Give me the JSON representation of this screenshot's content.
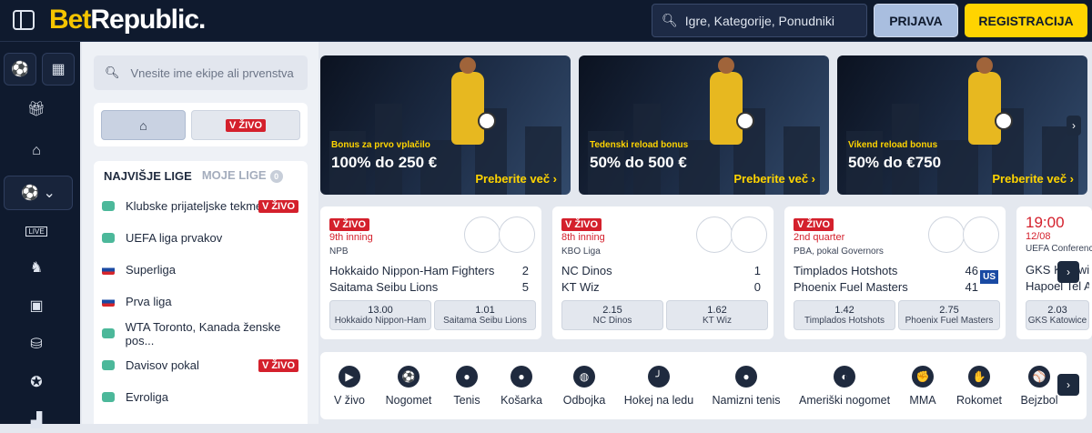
{
  "header": {
    "logo_bet": "Bet",
    "logo_republic": "Republic.",
    "search_placeholder": "Igre, Kategorije, Ponudniki",
    "login": "PRIJAVA",
    "register": "REGISTRACIJA"
  },
  "rail": {
    "icons": [
      "sports-icon",
      "casino-icon",
      "gift-icon",
      "home-icon",
      "football-icon",
      "live-icon",
      "horse-icon",
      "ticket-icon",
      "basket-icon",
      "badge-icon",
      "building-icon"
    ],
    "live_label": "LIVE"
  },
  "left": {
    "search_placeholder": "Vnesite ime ekipe ali prvenstva",
    "live_label": "V ŽIVO",
    "tab_top": "NAJVIŠJE LIGE",
    "tab_mine": "MOJE LIGE",
    "mine_count": "0",
    "leagues": [
      {
        "name": "Klubske prijateljske tekme",
        "flag": "globe",
        "live": "V ŽIVO"
      },
      {
        "name": "UEFA liga prvakov",
        "flag": "globe",
        "live": ""
      },
      {
        "name": "Superliga",
        "flag": "sk",
        "live": ""
      },
      {
        "name": "Prva liga",
        "flag": "si",
        "live": ""
      },
      {
        "name": "WTA Toronto, Kanada ženske pos...",
        "flag": "globe",
        "live": ""
      },
      {
        "name": "Davisov pokal",
        "flag": "globe",
        "live": "V ŽIVO"
      },
      {
        "name": "Evroliga",
        "flag": "globe",
        "live": ""
      }
    ]
  },
  "banners": [
    {
      "small": "Bonus za prvo vplačilo",
      "big": "100% do 250 €",
      "more": "Preberite več"
    },
    {
      "small": "Tedenski reload bonus",
      "big": "50% do 500 €",
      "more": "Preberite več"
    },
    {
      "small": "Vikend reload bonus",
      "big": "50% do €750",
      "more": "Preberite več"
    }
  ],
  "matches": [
    {
      "status": "V ŽIVO",
      "period": "9th inning",
      "competition": "NPB",
      "home": "Hokkaido Nippon-Ham Fighters",
      "away": "Saitama Seibu Lions",
      "home_score": "2",
      "away_score": "5",
      "odds": [
        {
          "v": "13.00",
          "n": "Hokkaido Nippon-Ham"
        },
        {
          "v": "1.01",
          "n": "Saitama Seibu Lions"
        }
      ]
    },
    {
      "status": "V ŽIVO",
      "period": "8th inning",
      "competition": "KBO Liga",
      "home": "NC Dinos",
      "away": "KT Wiz",
      "home_score": "1",
      "away_score": "0",
      "odds": [
        {
          "v": "2.15",
          "n": "NC Dinos"
        },
        {
          "v": "1.62",
          "n": "KT Wiz"
        }
      ]
    },
    {
      "status": "V ŽIVO",
      "period": "2nd quarter",
      "competition": "PBA, pokal Governors",
      "home": "Timplados Hotshots",
      "away": "Phoenix Fuel Masters",
      "home_score": "46",
      "away_score": "41",
      "odds": [
        {
          "v": "1.42",
          "n": "Timplados Hotshots"
        },
        {
          "v": "2.75",
          "n": "Phoenix Fuel Masters"
        }
      ],
      "country": "US"
    },
    {
      "time": "19:00",
      "date": "12/08",
      "competition": "UEFA Conference",
      "home": "GKS Katowice",
      "away": "Hapoel Tel Aviv",
      "odds": [
        {
          "v": "2.03",
          "n": "GKS Katowice"
        }
      ]
    }
  ],
  "sports": [
    {
      "label": "V živo",
      "icon": "play-icon",
      "glyph": "▶"
    },
    {
      "label": "Nogomet",
      "icon": "soccer-icon",
      "glyph": "⚽"
    },
    {
      "label": "Tenis",
      "icon": "tennis-icon",
      "glyph": "●"
    },
    {
      "label": "Košarka",
      "icon": "basketball-icon",
      "glyph": "●"
    },
    {
      "label": "Odbojka",
      "icon": "volleyball-icon",
      "glyph": "◍"
    },
    {
      "label": "Hokej na ledu",
      "icon": "hockey-icon",
      "glyph": "╯"
    },
    {
      "label": "Namizni tenis",
      "icon": "table-tennis-icon",
      "glyph": "●"
    },
    {
      "label": "Ameriški nogomet",
      "icon": "helmet-icon",
      "glyph": "◐"
    },
    {
      "label": "MMA",
      "icon": "glove-icon",
      "glyph": "✊"
    },
    {
      "label": "Rokomet",
      "icon": "handball-icon",
      "glyph": "✋"
    },
    {
      "label": "Bejzbol",
      "icon": "baseball-icon",
      "glyph": "⚾"
    }
  ]
}
